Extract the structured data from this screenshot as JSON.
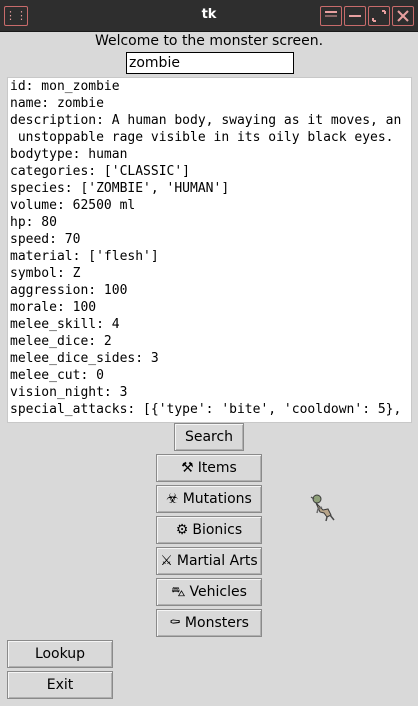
{
  "window": {
    "title": "tk"
  },
  "welcome": "Welcome to the monster screen.",
  "search": {
    "value": "zombie"
  },
  "output_text": "id: mon_zombie\nname: zombie\ndescription: A human body, swaying as it moves, an\n unstoppable rage visible in its oily black eyes.\nbodytype: human\ncategories: ['CLASSIC']\nspecies: ['ZOMBIE', 'HUMAN']\nvolume: 62500 ml\nhp: 80\nspeed: 70\nmaterial: ['flesh']\nsymbol: Z\naggression: 100\nmorale: 100\nmelee_skill: 4\nmelee_dice: 2\nmelee_dice_sides: 3\nmelee_cut: 0\nvision_night: 3\nspecial_attacks: [{'type': 'bite', 'cooldown': 5},",
  "buttons": {
    "search": "Search",
    "items": {
      "icon": "⚒",
      "label": "Items"
    },
    "mutations": {
      "icon": "☣",
      "label": "Mutations"
    },
    "bionics": {
      "icon": "⚙",
      "label": "Bionics"
    },
    "martial_arts": {
      "icon": "⚔",
      "label": "Martial Arts"
    },
    "vehicles": {
      "icon": "⛍",
      "label": "Vehicles"
    },
    "monsters": {
      "icon": "⚰",
      "label": "Monsters"
    },
    "lookup": "Lookup",
    "exit": "Exit"
  },
  "sprite": {
    "icon": "zombie-sprite-icon"
  }
}
